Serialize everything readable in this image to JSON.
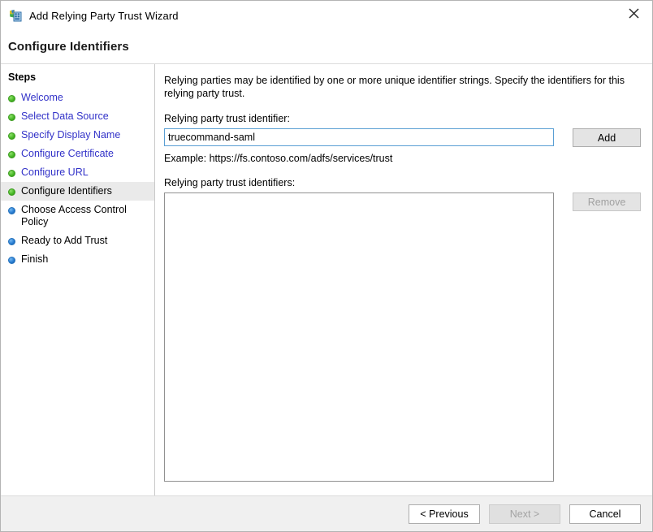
{
  "window": {
    "title": "Add Relying Party Trust Wizard",
    "icon": "adfs-wizard-icon",
    "close_label": "×"
  },
  "heading": {
    "title": "Configure Identifiers"
  },
  "sidebar": {
    "title": "Steps",
    "items": [
      {
        "label": "Welcome",
        "state": "done",
        "bullet": "green-bullet-icon"
      },
      {
        "label": "Select Data Source",
        "state": "done",
        "bullet": "green-bullet-icon"
      },
      {
        "label": "Specify Display Name",
        "state": "done",
        "bullet": "green-bullet-icon"
      },
      {
        "label": "Configure Certificate",
        "state": "done",
        "bullet": "green-bullet-icon"
      },
      {
        "label": "Configure URL",
        "state": "done",
        "bullet": "green-bullet-icon"
      },
      {
        "label": "Configure Identifiers",
        "state": "current",
        "bullet": "green-bullet-icon"
      },
      {
        "label": "Choose Access Control Policy",
        "state": "todo",
        "bullet": "blue-bullet-icon"
      },
      {
        "label": "Ready to Add Trust",
        "state": "todo",
        "bullet": "blue-bullet-icon"
      },
      {
        "label": "Finish",
        "state": "todo",
        "bullet": "blue-bullet-icon"
      }
    ]
  },
  "main": {
    "intro": "Relying parties may be identified by one or more unique identifier strings. Specify the identifiers for this relying party trust.",
    "identifier_label": "Relying party trust identifier:",
    "identifier_value": "truecommand-saml",
    "identifier_placeholder": "",
    "add_label": "Add",
    "example_text": "Example: https://fs.contoso.com/adfs/services/trust",
    "identifiers_list_label": "Relying party trust identifiers:",
    "identifiers_list_items": [],
    "remove_label": "Remove",
    "remove_disabled": true
  },
  "footer": {
    "previous_label": "< Previous",
    "next_label": "Next >",
    "next_disabled": true,
    "cancel_label": "Cancel"
  },
  "colors": {
    "link": "#3232c8",
    "bullet_done": "#49b928",
    "bullet_todo": "#2a7fd4",
    "focus_border": "#5a9fd4",
    "footer_bg": "#f0f0f0",
    "current_step_bg": "#eaeaea"
  }
}
